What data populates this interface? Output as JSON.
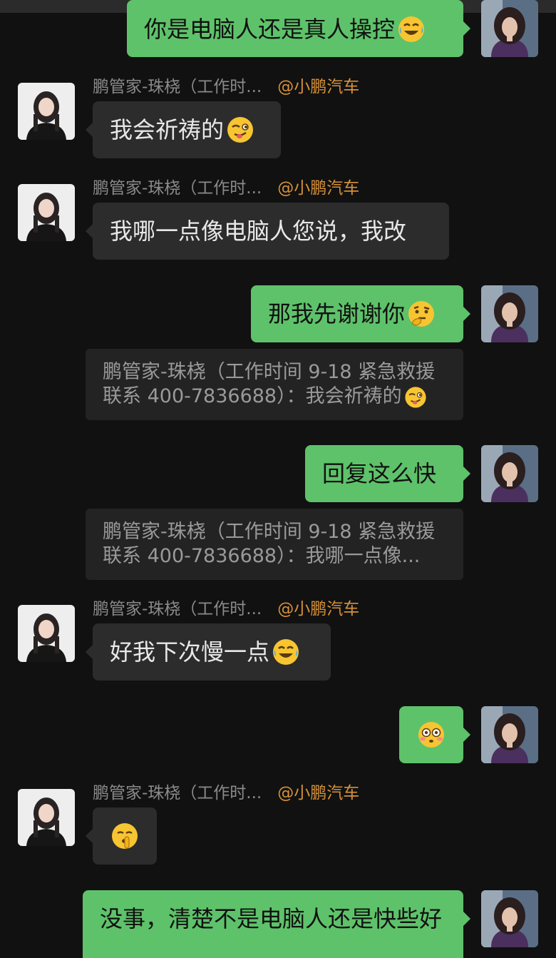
{
  "chat": {
    "messages": [
      {
        "side": "out",
        "text": "你是电脑人还是真人操控",
        "emoji": "laughing-tears-emoji"
      },
      {
        "side": "in",
        "sender": "鹏管家-珠桡（工作时...",
        "tag": "@小鹏汽车",
        "text": "我会祈祷的",
        "emoji": "wink-tongue-emoji"
      },
      {
        "side": "in",
        "sender": "鹏管家-珠桡（工作时...",
        "tag": "@小鹏汽车",
        "text": "我哪一点像电脑人您说，我改"
      },
      {
        "side": "out",
        "text": "那我先谢谢你",
        "emoji": "thinking-emoji"
      },
      {
        "side": "quote",
        "line1": "鹏管家-珠桡（工作时间 9-18 紧急救援",
        "line2": "联系 400-7836688）：我会祈祷的",
        "emoji": "wink-tongue-emoji"
      },
      {
        "side": "out",
        "text": "回复这么快"
      },
      {
        "side": "quote",
        "line1": "鹏管家-珠桡（工作时间 9-18 紧急救援",
        "line2": "联系 400-7836688）：我哪一点像..."
      },
      {
        "side": "in",
        "sender": "鹏管家-珠桡（工作时...",
        "tag": "@小鹏汽车",
        "text": "好我下次慢一点",
        "emoji": "laughing-tears-emoji"
      },
      {
        "side": "out",
        "text": "",
        "emoji": "flushed-emoji"
      },
      {
        "side": "in",
        "sender": "鹏管家-珠桡（工作时...",
        "tag": "@小鹏汽车",
        "text": "",
        "emoji": "shushing-emoji"
      },
      {
        "side": "out",
        "text": "没事，清楚不是电脑人还是快些好"
      }
    ]
  },
  "colors": {
    "background": "#111111",
    "incoming_bubble": "#2c2c2c",
    "outgoing_bubble": "#5ec26a",
    "sender_name": "#8a8a8a",
    "sender_tag": "#d6913a",
    "quote_bg": "#232323"
  }
}
